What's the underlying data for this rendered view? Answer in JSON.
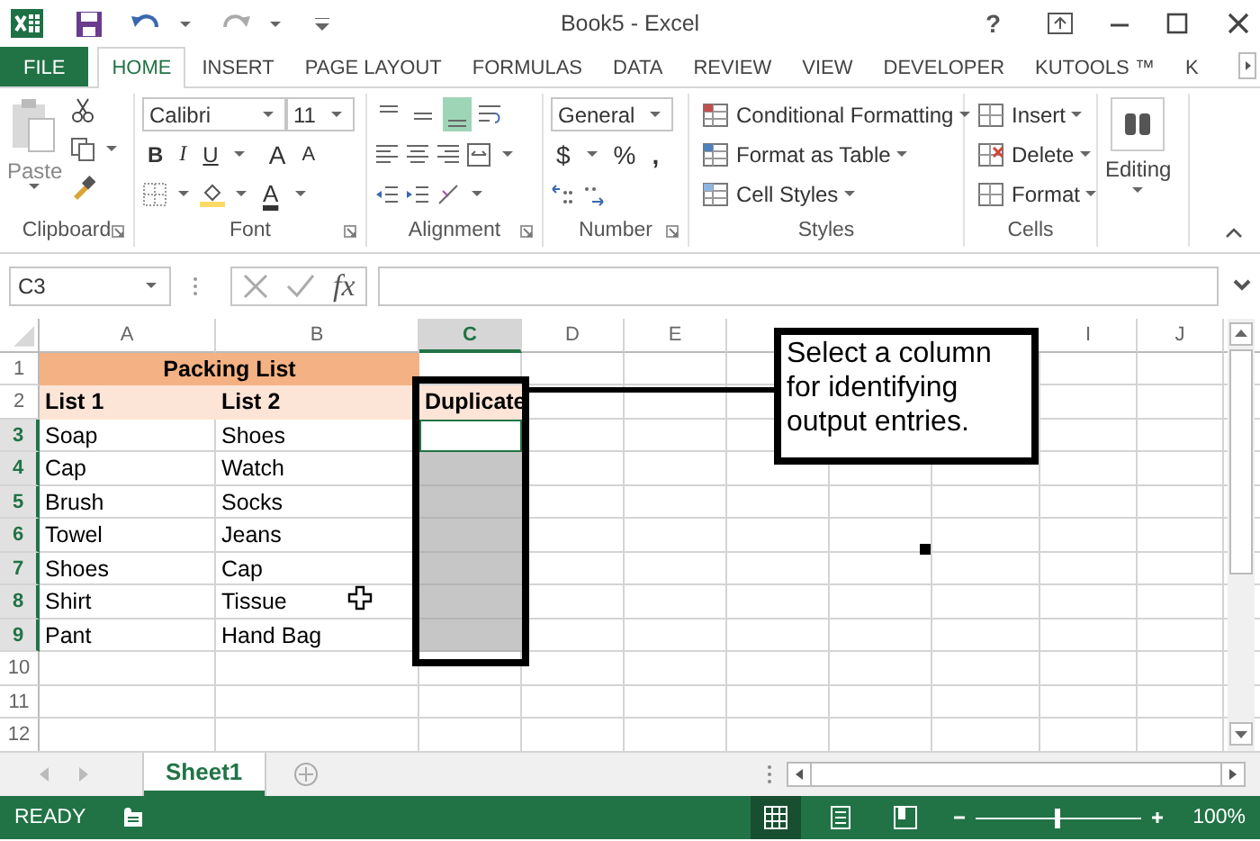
{
  "title_bar": {
    "title": "Book5 - Excel",
    "help": "?"
  },
  "ribbon_tabs": [
    {
      "label": "FILE",
      "kind": "file",
      "selected": false
    },
    {
      "label": "HOME",
      "kind": "tab",
      "selected": true
    },
    {
      "label": "INSERT",
      "kind": "tab",
      "selected": false
    },
    {
      "label": "PAGE LAYOUT",
      "kind": "tab",
      "selected": false
    },
    {
      "label": "FORMULAS",
      "kind": "tab",
      "selected": false
    },
    {
      "label": "DATA",
      "kind": "tab",
      "selected": false
    },
    {
      "label": "REVIEW",
      "kind": "tab",
      "selected": false
    },
    {
      "label": "VIEW",
      "kind": "tab",
      "selected": false
    },
    {
      "label": "DEVELOPER",
      "kind": "tab",
      "selected": false
    },
    {
      "label": "KUTOOLS ™",
      "kind": "tab",
      "selected": false
    },
    {
      "label": "K",
      "kind": "tab",
      "selected": false
    }
  ],
  "ribbon": {
    "clipboard": {
      "paste": "Paste",
      "label": "Clipboard"
    },
    "font": {
      "name": "Calibri",
      "size": "11",
      "bold": "B",
      "italic": "I",
      "underline": "U",
      "grow": "A",
      "shrink": "A",
      "font_color": "A",
      "label": "Font"
    },
    "alignment": {
      "vertical": [
        {
          "selected": false
        },
        {
          "selected": false
        },
        {
          "selected": true
        }
      ],
      "label": "Alignment"
    },
    "number": {
      "format": "General",
      "currency": "$",
      "percent": "%",
      "comma": ",",
      "label": "Number"
    },
    "styles": {
      "items": [
        "Conditional Formatting",
        "Format as Table",
        "Cell Styles"
      ],
      "label": "Styles"
    },
    "cells": {
      "items": [
        "Insert",
        "Delete",
        "Format"
      ],
      "label": "Cells"
    },
    "editing": {
      "label": "Editing"
    }
  },
  "formula_bar": {
    "name_box": "C3",
    "function_label": "fx"
  },
  "sheet": {
    "columns": [
      {
        "label": "A",
        "selected": false
      },
      {
        "label": "B",
        "selected": false
      },
      {
        "label": "C",
        "selected": true
      },
      {
        "label": "D",
        "selected": false
      },
      {
        "label": "E",
        "selected": false
      },
      {},
      {},
      {},
      {
        "label": "I",
        "selected": false
      },
      {
        "label": "J",
        "selected": false
      }
    ],
    "rows": [
      {
        "number": "1",
        "kind": "title",
        "selected": false,
        "title": "Packing List"
      },
      {
        "number": "2",
        "kind": "header",
        "selected": false,
        "cells": [
          "List 1",
          "List 2",
          "Duplicate"
        ]
      },
      {
        "number": "3",
        "kind": "data",
        "selected": true,
        "active": true,
        "cells": [
          "Soap",
          "Shoes"
        ]
      },
      {
        "number": "4",
        "kind": "data",
        "selected": true,
        "active": false,
        "cells": [
          "Cap",
          "Watch"
        ]
      },
      {
        "number": "5",
        "kind": "data",
        "selected": true,
        "active": false,
        "cells": [
          "Brush",
          "Socks"
        ]
      },
      {
        "number": "6",
        "kind": "data",
        "selected": true,
        "active": false,
        "cells": [
          "Towel",
          "Jeans"
        ]
      },
      {
        "number": "7",
        "kind": "data",
        "selected": true,
        "active": false,
        "cells": [
          "Shoes",
          "Cap"
        ]
      },
      {
        "number": "8",
        "kind": "data",
        "selected": true,
        "active": false,
        "cells": [
          "Shirt",
          "Tissue"
        ]
      },
      {
        "number": "9",
        "kind": "data",
        "selected": true,
        "active": false,
        "cells": [
          "Pant",
          "Hand Bag"
        ]
      },
      {
        "number": "10",
        "kind": "data",
        "selected": false
      },
      {
        "number": "11",
        "kind": "data",
        "selected": false
      },
      {
        "number": "12",
        "kind": "data",
        "selected": false
      }
    ]
  },
  "callout": {
    "text": "Select a column for identifying output entries."
  },
  "sheet_tabs": [
    {
      "label": "Sheet1",
      "selected": true
    }
  ],
  "status_bar": {
    "status": "READY",
    "views": [
      {
        "selected": true
      },
      {
        "selected": false
      },
      {
        "selected": false
      }
    ],
    "zoom": {
      "level": 0.5
    },
    "zoom_reading": "100%"
  }
}
